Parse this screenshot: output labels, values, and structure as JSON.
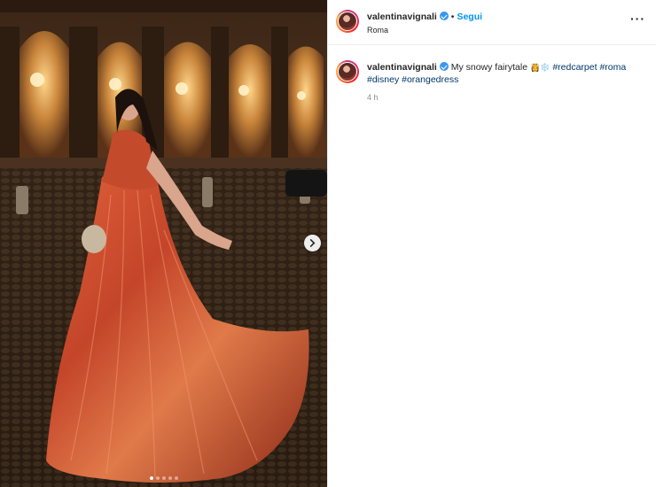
{
  "post": {
    "user": {
      "username": "valentinavignali",
      "verified": true,
      "location": "Roma",
      "follow_label": "Segui",
      "separator": "•"
    },
    "more_icon": "more-horizontal-icon",
    "caption": {
      "text": "My snowy fairytale",
      "emojis": "👸❄️",
      "hashtags": [
        "#redcarpet",
        "#roma",
        "#disney",
        "#orangedress"
      ]
    },
    "time_ago": "4 h",
    "carousel": {
      "total": 5,
      "current": 1,
      "next_icon": "chevron-right-icon"
    },
    "colors": {
      "link_blue": "#0095f6",
      "hashtag": "#00376b",
      "verified": "#3897f0"
    }
  }
}
